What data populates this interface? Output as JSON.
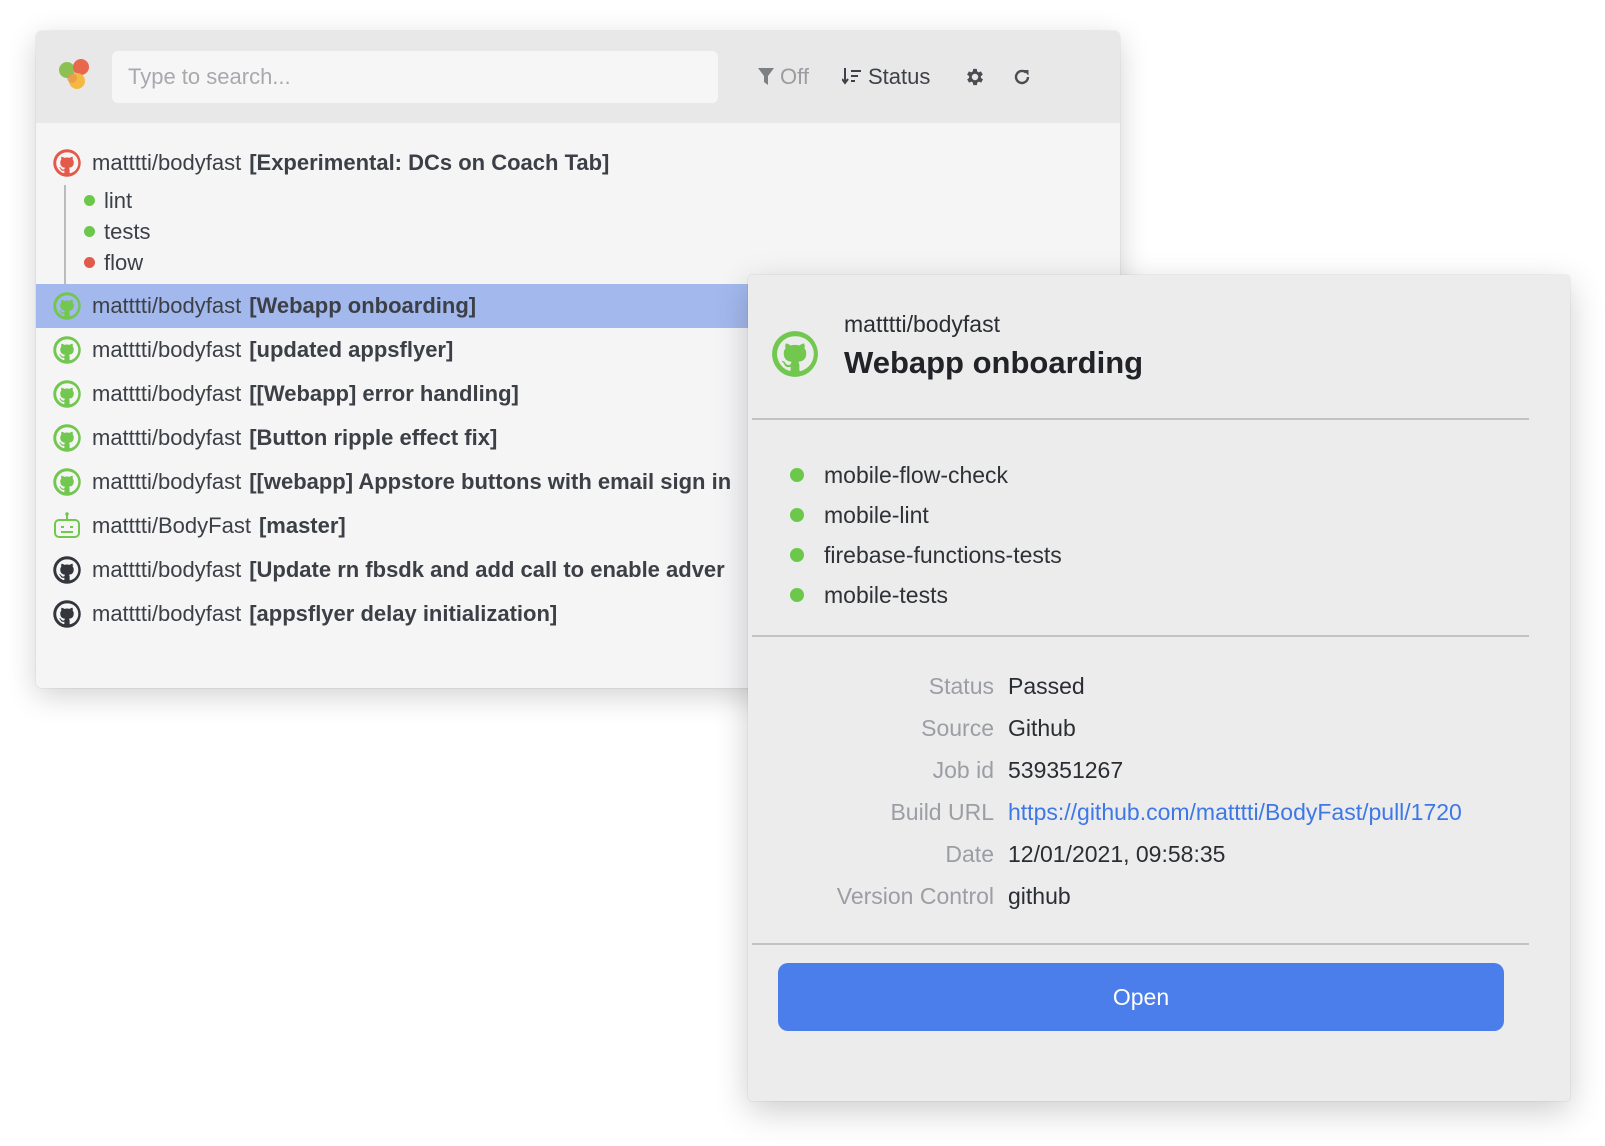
{
  "colors": {
    "accent": "#4b7eea",
    "selected_row": "#a3b9ee",
    "status_green": "#6cc84a",
    "status_red": "#e05a4d",
    "link": "#3d78e6"
  },
  "toolbar": {
    "search_placeholder": "Type to search...",
    "filter_label": "Off",
    "sort_label": "Status",
    "icons": [
      "app-logo-icon",
      "filter-icon",
      "sort-icon",
      "gear-icon",
      "refresh-icon"
    ]
  },
  "list": {
    "expanded": {
      "repo": "matttti/bodyfast",
      "branch": "[Experimental: DCs on Coach Tab]",
      "icon": "github-failed",
      "children": [
        {
          "label": "lint",
          "status": "green"
        },
        {
          "label": "tests",
          "status": "green"
        },
        {
          "label": "flow",
          "status": "red"
        }
      ]
    },
    "rows": [
      {
        "repo": "matttti/bodyfast",
        "branch": "[Webapp onboarding]",
        "icon": "github-passed",
        "selected": true
      },
      {
        "repo": "matttti/bodyfast",
        "branch": "[updated appsflyer]",
        "icon": "github-passed"
      },
      {
        "repo": "matttti/bodyfast",
        "branch": "[[Webapp] error handling]",
        "icon": "github-passed"
      },
      {
        "repo": "matttti/bodyfast",
        "branch": "[Button ripple effect fix]",
        "icon": "github-passed"
      },
      {
        "repo": "matttti/bodyfast",
        "branch": "[[webapp] Appstore buttons with email sign in",
        "icon": "github-passed"
      },
      {
        "repo": "matttti/BodyFast",
        "branch": "[master]",
        "icon": "bot-passed"
      },
      {
        "repo": "matttti/bodyfast",
        "branch": "[Update rn fbsdk and add call to enable adver",
        "icon": "github-neutral"
      },
      {
        "repo": "matttti/bodyfast",
        "branch": "[appsflyer delay initialization]",
        "icon": "github-neutral"
      }
    ]
  },
  "detail": {
    "repo": "matttti/bodyfast",
    "title": "Webapp onboarding",
    "checks": [
      {
        "label": "mobile-flow-check",
        "status": "green"
      },
      {
        "label": "mobile-lint",
        "status": "green"
      },
      {
        "label": "firebase-functions-tests",
        "status": "green"
      },
      {
        "label": "mobile-tests",
        "status": "green"
      }
    ],
    "fields": {
      "status_label": "Status",
      "status_value": "Passed",
      "source_label": "Source",
      "source_value": "Github",
      "job_label": "Job id",
      "job_value": "539351267",
      "url_label": "Build URL",
      "url_value": "https://github.com/matttti/BodyFast/pull/1720",
      "date_label": "Date",
      "date_value": "12/01/2021, 09:58:35",
      "vc_label": "Version Control",
      "vc_value": "github"
    },
    "open_label": "Open"
  }
}
